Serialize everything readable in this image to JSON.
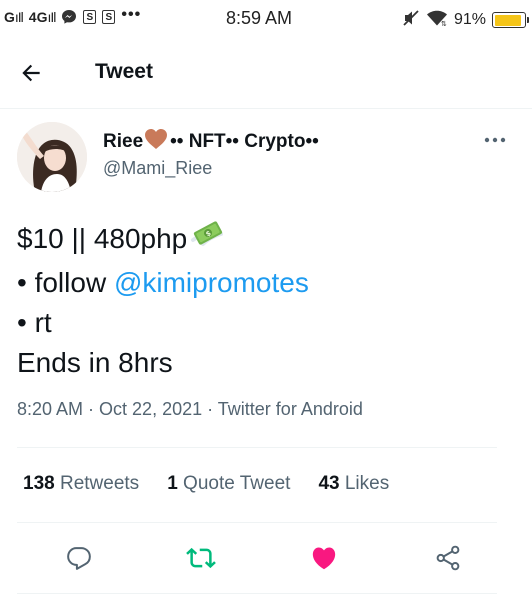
{
  "status_bar": {
    "signal1": "G",
    "signal2": "4G",
    "box1": "S",
    "box2": "S",
    "overflow": "•••",
    "time": "8:59 AM",
    "battery_pct": "91%",
    "battery_level": 0.91,
    "icons": [
      "messenger-icon",
      "mute-icon",
      "wifi-icon",
      "battery-icon"
    ]
  },
  "header": {
    "title": "Tweet",
    "back_icon": "arrow-left-icon"
  },
  "tweet": {
    "author": {
      "name_part1": "Riee",
      "name_part2": "•• NFT•• Crypto••",
      "handle": "@Mami_Riee"
    },
    "lines": {
      "line1": "$10 || 480php",
      "line2_prefix": "• follow ",
      "line2_mention": "@kimipromotes",
      "line3": "• rt",
      "line4": "Ends in 8hrs"
    },
    "meta": {
      "time": "8:20 AM",
      "sep1": " · ",
      "date": "Oct 22, 2021",
      "sep2": " · ",
      "source": "Twitter for Android"
    },
    "stats": {
      "retweets_count": "138",
      "retweets_label": " Retweets",
      "quotes_count": "1",
      "quotes_label": " Quote Tweet",
      "likes_count": "43",
      "likes_label": " Likes"
    }
  },
  "colors": {
    "accent": "#1d9bf0",
    "retweet": "#00ba7c",
    "like": "#f91880",
    "secondary_text": "#536471",
    "heart_emoji": "#c97a5a"
  }
}
